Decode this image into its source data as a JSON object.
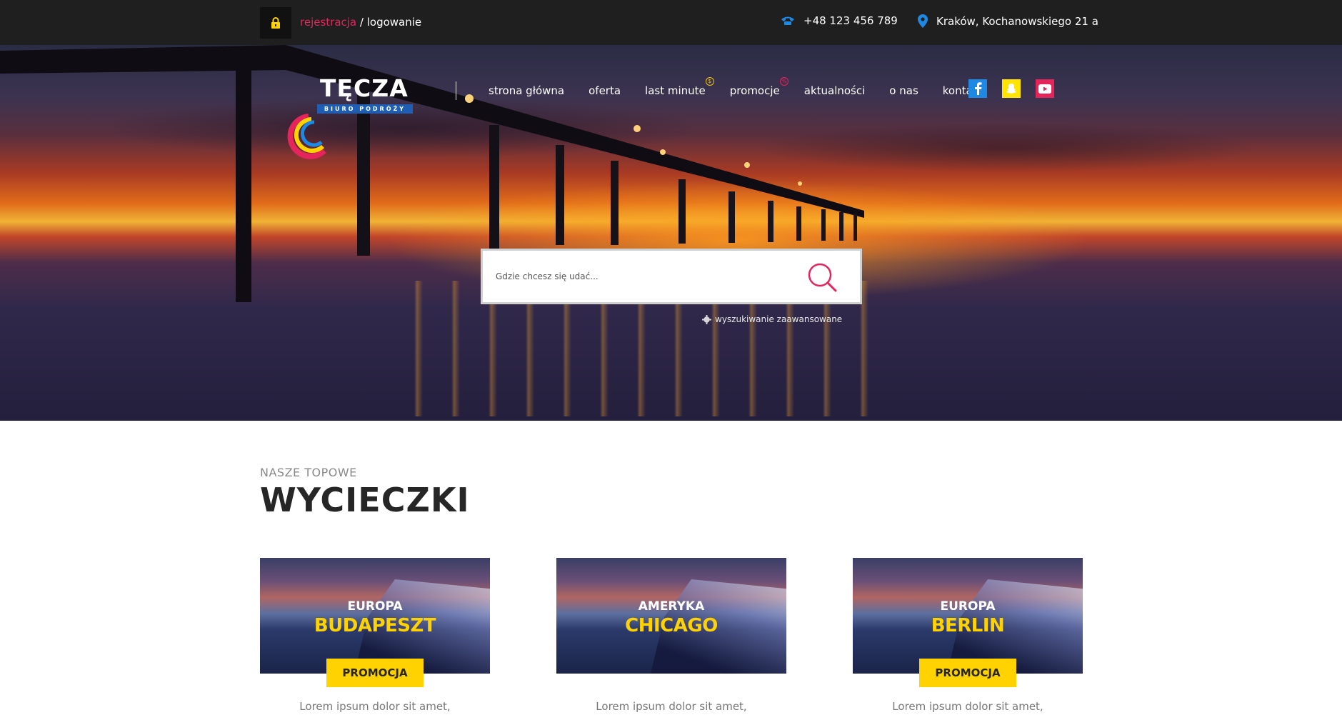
{
  "topbar": {
    "register_label": "rejestracja",
    "separator": " / ",
    "login_label": "logowanie",
    "phone": "+48 123 456 789",
    "address": "Kraków, Kochanowskiego 21 a"
  },
  "logo": {
    "name": "TĘCZA",
    "tagline": "BIURO PODRÓŻY"
  },
  "nav": {
    "items": [
      {
        "label": "strona główna"
      },
      {
        "label": "oferta"
      },
      {
        "label": "last minute",
        "badge": "$"
      },
      {
        "label": "promocje",
        "badge": "%"
      },
      {
        "label": "aktualności"
      },
      {
        "label": "o nas"
      },
      {
        "label": "kontakt"
      }
    ]
  },
  "social": {
    "icons": [
      "facebook-icon",
      "snapchat-icon",
      "youtube-icon"
    ]
  },
  "search": {
    "placeholder": "Gdzie chcesz się udać...",
    "advanced_label": "wyszukiwanie zaawansowane"
  },
  "section": {
    "subtitle": "NASZE TOPOWE",
    "title": "WYCIECZKI"
  },
  "cards": [
    {
      "continent": "EUROPA",
      "city": "BUDAPESZT",
      "promo": "PROMOCJA",
      "description": "Lorem ipsum dolor sit amet,"
    },
    {
      "continent": "AMERYKA",
      "city": "CHICAGO",
      "promo": "",
      "description": "Lorem ipsum dolor sit amet,"
    },
    {
      "continent": "EUROPA",
      "city": "BERLIN",
      "promo": "PROMOCJA",
      "description": "Lorem ipsum dolor sit amet,"
    }
  ],
  "colors": {
    "accent_pink": "#e4245b",
    "accent_yellow": "#ffd200",
    "topbar_bg": "#1f1f1f",
    "icon_blue": "#1e88e5"
  }
}
